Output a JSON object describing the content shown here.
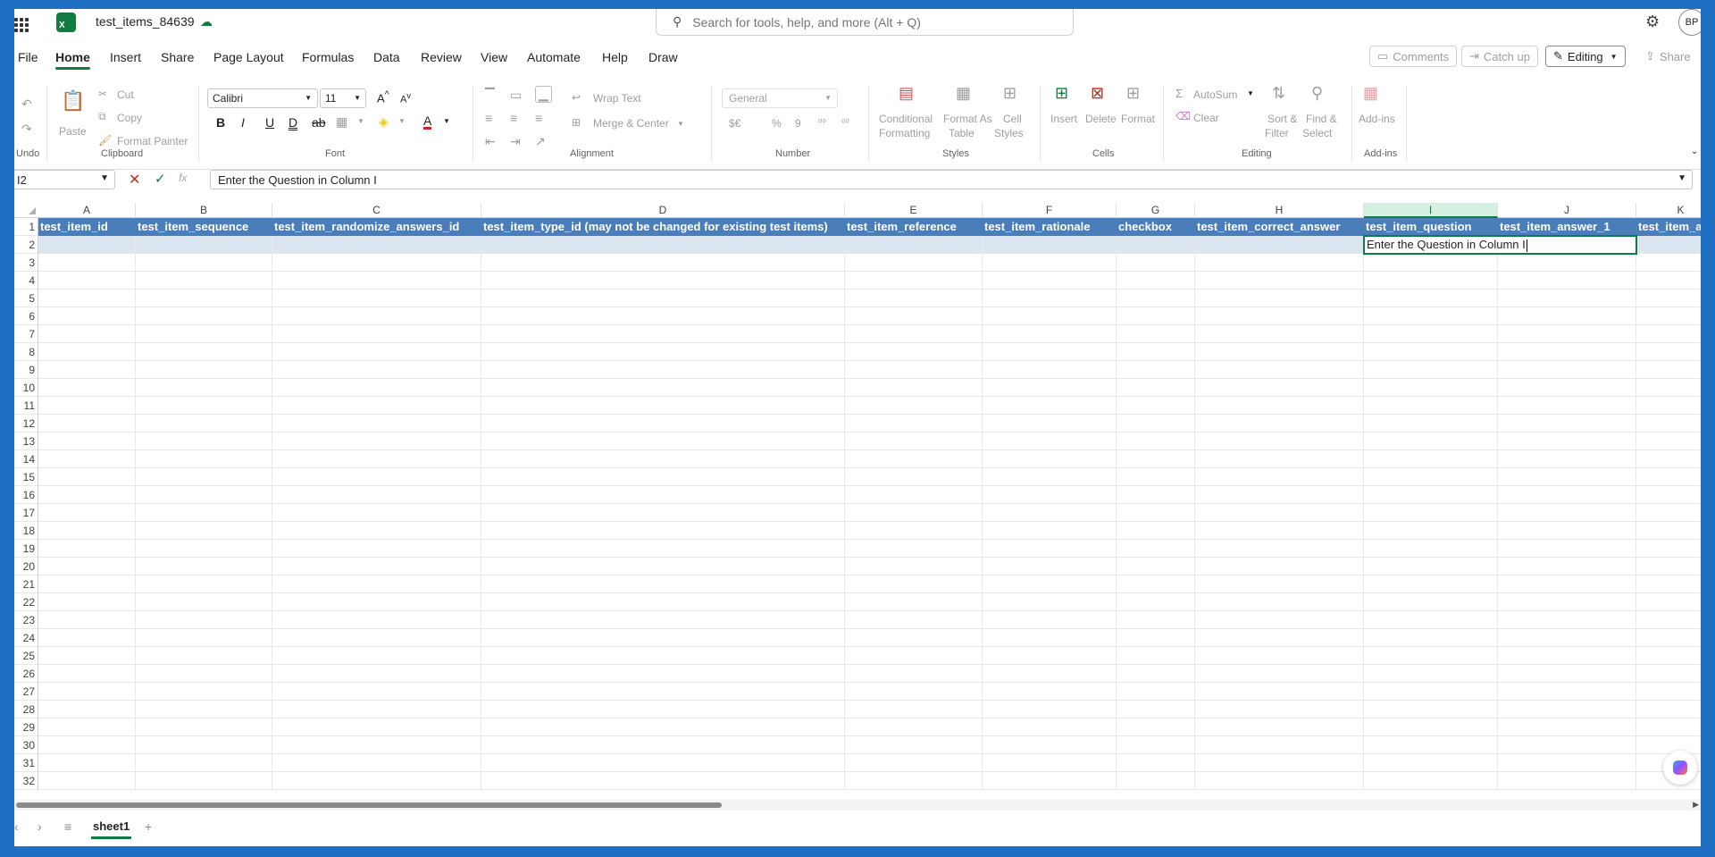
{
  "titlebar": {
    "doc_title": "test_items_84639",
    "search_placeholder": "Search for tools, help, and more (Alt + Q)",
    "avatar_initials": "BP"
  },
  "menu": {
    "tabs": [
      "File",
      "Home",
      "Insert",
      "Share",
      "Page Layout",
      "Formulas",
      "Data",
      "Review",
      "View",
      "Automate",
      "Help",
      "Draw"
    ],
    "active": "Home",
    "comments": "Comments",
    "catch_up": "Catch up",
    "editing": "Editing",
    "share": "Share"
  },
  "ribbon": {
    "undo_label": "Undo",
    "paste": "Paste",
    "cut": "Cut",
    "copy": "Copy",
    "format_painter": "Format Painter",
    "clipboard_label": "Clipboard",
    "font_name": "Calibri",
    "font_size": "11",
    "font_label": "Font",
    "wrap_text": "Wrap Text",
    "merge_center": "Merge & Center",
    "alignment_label": "Alignment",
    "number_format": "General",
    "number_label": "Number",
    "conditional_formatting": [
      "Conditional",
      "Formatting"
    ],
    "format_as_table": [
      "Format As",
      "Table"
    ],
    "cell_styles": [
      "Cell",
      "Styles"
    ],
    "styles_label": "Styles",
    "insert": "Insert",
    "delete": "Delete",
    "format": "Format",
    "cells_label": "Cells",
    "autosum": "AutoSum",
    "clear": "Clear",
    "sort_filter": [
      "Sort &",
      "Filter"
    ],
    "find_select": [
      "Find &",
      "Select"
    ],
    "editing_label": "Editing",
    "addins": "Add-ins",
    "addins_label": "Add-ins"
  },
  "formula_bar": {
    "name_box": "I2",
    "content": "Enter the Question in Column I"
  },
  "sheet": {
    "columns": [
      "A",
      "B",
      "C",
      "D",
      "E",
      "F",
      "G",
      "H",
      "I",
      "J",
      "K"
    ],
    "selected_column": "I",
    "header_row": [
      "test_item_id",
      "test_item_sequence",
      "test_item_randomize_answers_id",
      "test_item_type_id (may not be changed for existing test items)",
      "test_item_reference",
      "test_item_rationale",
      "checkbox",
      "test_item_correct_answer",
      "test_item_question",
      "test_item_answer_1",
      "test_item_a"
    ],
    "active_cell_text": "Enter the Question in Column I",
    "row_numbers": [
      "1",
      "2",
      "3",
      "4",
      "5",
      "6",
      "7",
      "8",
      "9",
      "10",
      "11",
      "12",
      "13",
      "14",
      "15",
      "16",
      "17",
      "18",
      "19",
      "20",
      "21",
      "22",
      "23",
      "24",
      "25",
      "26",
      "27",
      "28",
      "29",
      "30",
      "31",
      "32"
    ]
  },
  "sheet_tabs": {
    "active": "sheet1"
  }
}
